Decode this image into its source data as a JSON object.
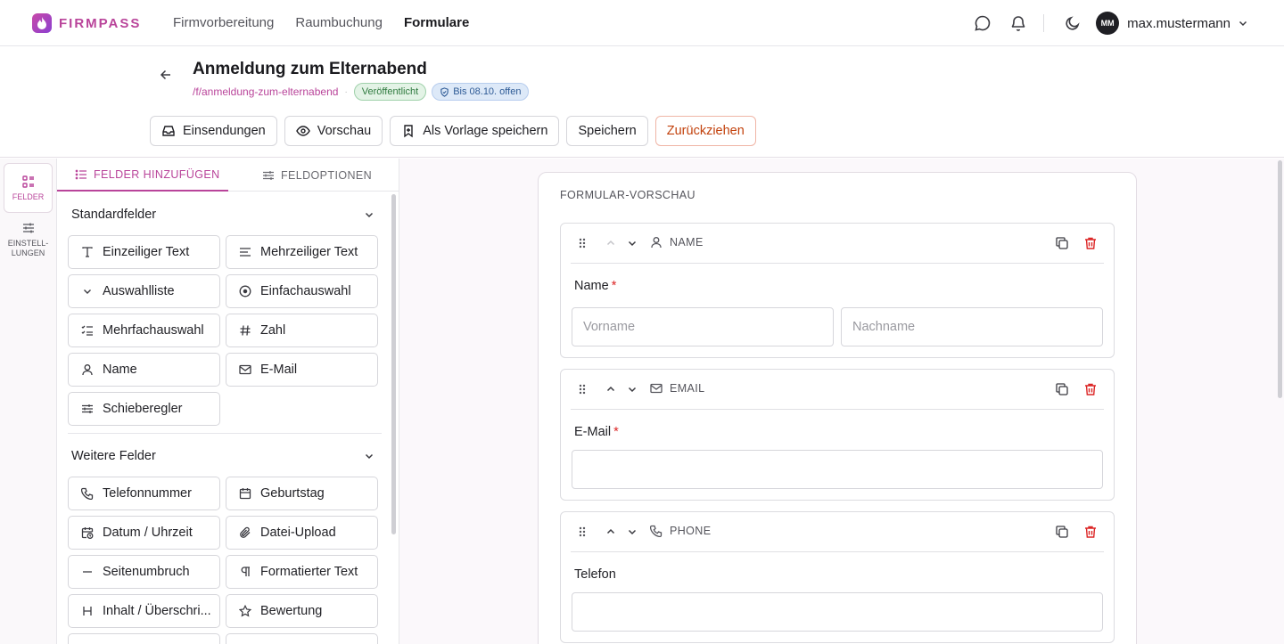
{
  "nav": {
    "brand": "FIRMPASS",
    "links": [
      "Firmvorbereitung",
      "Raumbuchung",
      "Formulare"
    ],
    "active_link": "Formulare",
    "avatar_initials": "MM",
    "username": "max.mustermann"
  },
  "header": {
    "title": "Anmeldung zum Elternabend",
    "slug": "/f/anmeldung-zum-elternabend",
    "status_badge": "Veröffentlicht",
    "deadline_badge": "Bis 08.10. offen",
    "actions": {
      "submissions": "Einsendungen",
      "preview": "Vorschau",
      "save_template": "Als Vorlage speichern",
      "save": "Speichern",
      "withdraw": "Zurückziehen"
    }
  },
  "rail": {
    "fields": "FELDER",
    "settings_line1": "EINSTELL-",
    "settings_line2": "LUNGEN"
  },
  "palette": {
    "tabs": [
      "FELDER HINZUFÜGEN",
      "FELDOPTIONEN"
    ],
    "standard": {
      "title": "Standardfelder",
      "items": [
        "Einzeiliger Text",
        "Mehrzeiliger Text",
        "Auswahlliste",
        "Einfachauswahl",
        "Mehrfachauswahl",
        "Zahl",
        "Name",
        "E-Mail",
        "Schieberegler"
      ]
    },
    "more": {
      "title": "Weitere Felder",
      "items": [
        "Telefonnummer",
        "Geburtstag",
        "Datum / Uhrzeit",
        "Datei-Upload",
        "Seitenumbruch",
        "Formatierter Text",
        "Inhalt / Überschri...",
        "Bewertung"
      ]
    }
  },
  "preview": {
    "title": "FORMULAR-VORSCHAU",
    "fields": [
      {
        "type": "NAME",
        "label": "Name",
        "required": "*",
        "placeholders": [
          "Vorname",
          "Nachname"
        ]
      },
      {
        "type": "EMAIL",
        "label": "E-Mail",
        "required": "*"
      },
      {
        "type": "PHONE",
        "label": "Telefon"
      }
    ]
  },
  "colors": {
    "accent": "#b9449a",
    "danger": "#dc2626"
  }
}
